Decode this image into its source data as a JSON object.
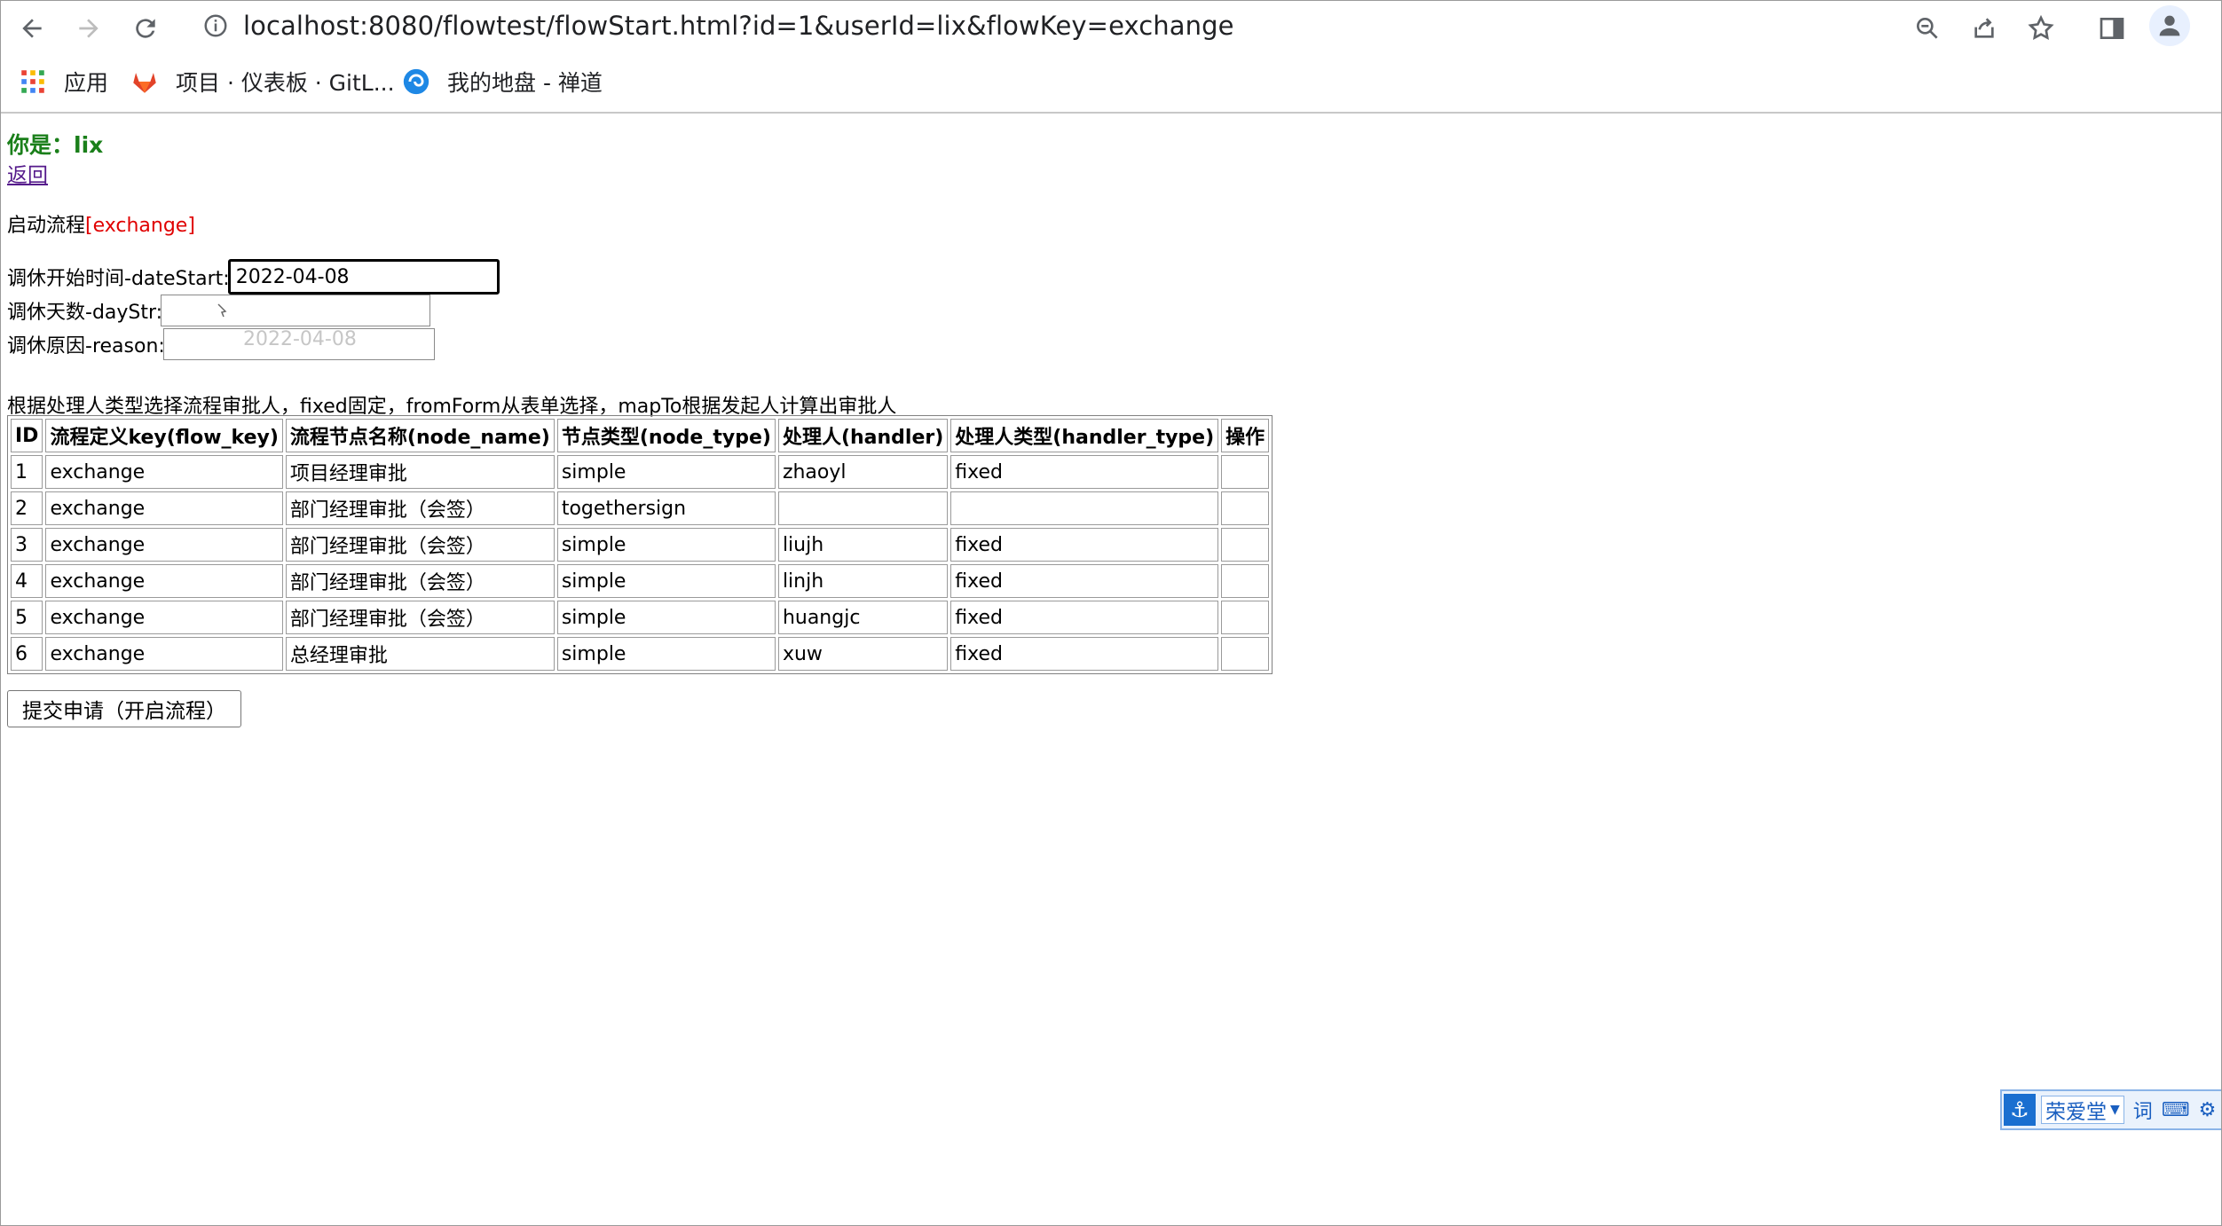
{
  "browser": {
    "url": "localhost:8080/flowtest/flowStart.html?id=1&userId=lix&flowKey=exchange",
    "bookmarks": [
      {
        "label": "应用",
        "icon": "apps-grid-icon"
      },
      {
        "label": "项目 · 仪表板 · GitL...",
        "icon": "gitlab-icon"
      },
      {
        "label": "我的地盘 - 禅道",
        "icon": "zentao-icon"
      }
    ]
  },
  "page": {
    "greeting": "你是：lix",
    "back_link": "返回",
    "start_label": "启动流程",
    "flow_key": "[exchange]",
    "fields": {
      "date_start": {
        "label": "调休开始时间-dateStart:",
        "value": "2022-04-08"
      },
      "day_str": {
        "label": "调休天数-dayStr:",
        "value": ""
      },
      "reason": {
        "label": "调休原因-reason:",
        "value": ""
      },
      "autofill_suggestion": "2022-04-08"
    },
    "hint": "根据处理人类型选择流程审批人，fixed固定，fromForm从表单选择，mapTo根据发起人计算出审批人",
    "table": {
      "headers": [
        "ID",
        "流程定义key(flow_key)",
        "流程节点名称(node_name)",
        "节点类型(node_type)",
        "处理人(handler)",
        "处理人类型(handler_type)",
        "操作"
      ],
      "rows": [
        [
          "1",
          "exchange",
          "项目经理审批",
          "simple",
          "zhaoyl",
          "fixed",
          ""
        ],
        [
          "2",
          "exchange",
          "部门经理审批（会签）",
          "togethersign",
          "",
          "",
          ""
        ],
        [
          "3",
          "exchange",
          "部门经理审批（会签）",
          "simple",
          "liujh",
          "fixed",
          ""
        ],
        [
          "4",
          "exchange",
          "部门经理审批（会签）",
          "simple",
          "linjh",
          "fixed",
          ""
        ],
        [
          "5",
          "exchange",
          "部门经理审批（会签）",
          "simple",
          "huangjc",
          "fixed",
          ""
        ],
        [
          "6",
          "exchange",
          "总经理审批",
          "simple",
          "xuw",
          "fixed",
          ""
        ]
      ]
    },
    "submit_label": "提交申请（开启流程）"
  },
  "ime": {
    "name": "荣爱堂",
    "word_label": "词"
  },
  "colors": {
    "greeting": "#1a7f1a",
    "flow_key": "#e00000",
    "link": "#551a8b"
  }
}
